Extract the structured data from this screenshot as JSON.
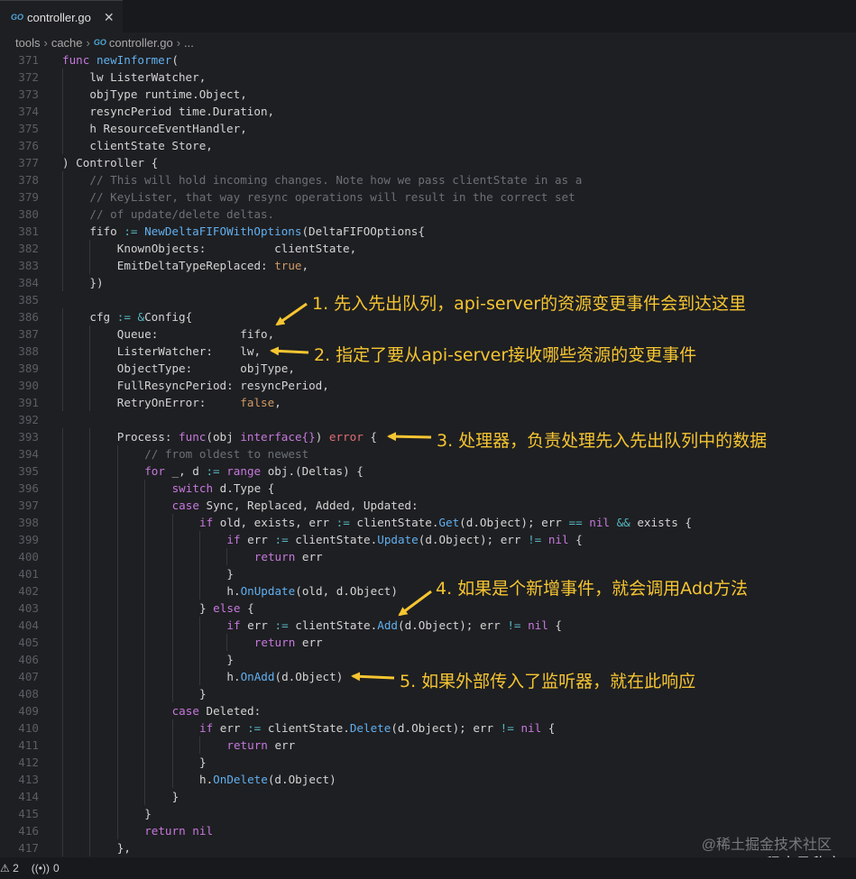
{
  "tab": {
    "icon": "go-file-icon",
    "icon_text": "GO",
    "filename": "controller.go",
    "close": "✕"
  },
  "breadcrumb": {
    "parts": [
      "tools",
      "cache",
      "controller.go",
      "..."
    ],
    "file_icon_text": "GO"
  },
  "code_lines": [
    {
      "n": "371",
      "i": 0,
      "tokens": [
        [
          "func",
          "k"
        ],
        [
          " ",
          ""
        ],
        [
          "newInformer",
          "f"
        ],
        [
          "(",
          ""
        ]
      ]
    },
    {
      "n": "372",
      "i": 1,
      "tokens": [
        [
          "lw ListerWatcher,",
          ""
        ]
      ]
    },
    {
      "n": "373",
      "i": 1,
      "tokens": [
        [
          "objType runtime.Object,",
          ""
        ]
      ]
    },
    {
      "n": "374",
      "i": 1,
      "tokens": [
        [
          "resyncPeriod time.Duration,",
          ""
        ]
      ]
    },
    {
      "n": "375",
      "i": 1,
      "tokens": [
        [
          "h ResourceEventHandler,",
          ""
        ]
      ]
    },
    {
      "n": "376",
      "i": 1,
      "tokens": [
        [
          "clientState Store,",
          ""
        ]
      ]
    },
    {
      "n": "377",
      "i": 0,
      "tokens": [
        [
          ") Controller {",
          ""
        ]
      ]
    },
    {
      "n": "378",
      "i": 1,
      "tokens": [
        [
          "// This will hold incoming changes. Note how we pass clientState in as a",
          "c"
        ]
      ]
    },
    {
      "n": "379",
      "i": 1,
      "tokens": [
        [
          "// KeyLister, that way resync operations will result in the correct set",
          "c"
        ]
      ]
    },
    {
      "n": "380",
      "i": 1,
      "tokens": [
        [
          "// of update/delete deltas.",
          "c"
        ]
      ]
    },
    {
      "n": "381",
      "i": 1,
      "tokens": [
        [
          "fifo ",
          ""
        ],
        [
          ":=",
          "o"
        ],
        [
          " ",
          ""
        ],
        [
          "NewDeltaFIFOWithOptions",
          "f"
        ],
        [
          "(DeltaFIFOOptions{",
          ""
        ]
      ]
    },
    {
      "n": "382",
      "i": 2,
      "tokens": [
        [
          "KnownObjects:          clientState,",
          ""
        ]
      ]
    },
    {
      "n": "383",
      "i": 2,
      "tokens": [
        [
          "EmitDeltaTypeReplaced: ",
          ""
        ],
        [
          "true",
          "b"
        ],
        [
          ",",
          ""
        ]
      ]
    },
    {
      "n": "384",
      "i": 1,
      "tokens": [
        [
          "})",
          ""
        ]
      ]
    },
    {
      "n": "385",
      "i": 0,
      "tokens": []
    },
    {
      "n": "386",
      "i": 1,
      "tokens": [
        [
          "cfg ",
          ""
        ],
        [
          ":=",
          "o"
        ],
        [
          " ",
          ""
        ],
        [
          "&",
          "o"
        ],
        [
          "Config{",
          ""
        ]
      ]
    },
    {
      "n": "387",
      "i": 2,
      "tokens": [
        [
          "Queue:            fifo,",
          ""
        ]
      ]
    },
    {
      "n": "388",
      "i": 2,
      "tokens": [
        [
          "ListerWatcher:    lw,",
          ""
        ]
      ]
    },
    {
      "n": "389",
      "i": 2,
      "tokens": [
        [
          "ObjectType:       objType,",
          ""
        ]
      ]
    },
    {
      "n": "390",
      "i": 2,
      "tokens": [
        [
          "FullResyncPeriod: resyncPeriod,",
          ""
        ]
      ]
    },
    {
      "n": "391",
      "i": 2,
      "tokens": [
        [
          "RetryOnError:     ",
          ""
        ],
        [
          "false",
          "b"
        ],
        [
          ",",
          ""
        ]
      ]
    },
    {
      "n": "392",
      "i": 0,
      "tokens": []
    },
    {
      "n": "393",
      "i": 2,
      "tokens": [
        [
          "Process: ",
          ""
        ],
        [
          "func",
          "k"
        ],
        [
          "(obj ",
          ""
        ],
        [
          "interface{}",
          "k"
        ],
        [
          ") ",
          ""
        ],
        [
          "error",
          "r"
        ],
        [
          " {",
          ""
        ]
      ]
    },
    {
      "n": "394",
      "i": 3,
      "tokens": [
        [
          "// from oldest to newest",
          "c"
        ]
      ]
    },
    {
      "n": "395",
      "i": 3,
      "tokens": [
        [
          "for",
          "k"
        ],
        [
          " _, d ",
          ""
        ],
        [
          ":=",
          "o"
        ],
        [
          " ",
          ""
        ],
        [
          "range",
          "k"
        ],
        [
          " obj.(Deltas) {",
          ""
        ]
      ]
    },
    {
      "n": "396",
      "i": 4,
      "tokens": [
        [
          "switch",
          "k"
        ],
        [
          " d.Type {",
          ""
        ]
      ]
    },
    {
      "n": "397",
      "i": 4,
      "tokens": [
        [
          "case",
          "k"
        ],
        [
          " Sync, Replaced, Added, Updated:",
          ""
        ]
      ]
    },
    {
      "n": "398",
      "i": 5,
      "tokens": [
        [
          "if",
          "k"
        ],
        [
          " old, exists, err ",
          ""
        ],
        [
          ":=",
          "o"
        ],
        [
          " clientState.",
          ""
        ],
        [
          "Get",
          "f"
        ],
        [
          "(d.Object); err ",
          ""
        ],
        [
          "==",
          "o"
        ],
        [
          " ",
          ""
        ],
        [
          "nil",
          "k"
        ],
        [
          " ",
          ""
        ],
        [
          "&&",
          "o"
        ],
        [
          " exists {",
          ""
        ]
      ]
    },
    {
      "n": "399",
      "i": 6,
      "tokens": [
        [
          "if",
          "k"
        ],
        [
          " err ",
          ""
        ],
        [
          ":=",
          "o"
        ],
        [
          " clientState.",
          ""
        ],
        [
          "Update",
          "f"
        ],
        [
          "(d.Object); err ",
          ""
        ],
        [
          "!=",
          "o"
        ],
        [
          " ",
          ""
        ],
        [
          "nil",
          "k"
        ],
        [
          " {",
          ""
        ]
      ]
    },
    {
      "n": "400",
      "i": 7,
      "tokens": [
        [
          "return",
          "k"
        ],
        [
          " err",
          ""
        ]
      ]
    },
    {
      "n": "401",
      "i": 6,
      "tokens": [
        [
          "}",
          ""
        ]
      ]
    },
    {
      "n": "402",
      "i": 6,
      "tokens": [
        [
          "h.",
          ""
        ],
        [
          "OnUpdate",
          "f"
        ],
        [
          "(old, d.Object)",
          ""
        ]
      ]
    },
    {
      "n": "403",
      "i": 5,
      "tokens": [
        [
          "} ",
          ""
        ],
        [
          "else",
          "k"
        ],
        [
          " {",
          ""
        ]
      ]
    },
    {
      "n": "404",
      "i": 6,
      "tokens": [
        [
          "if",
          "k"
        ],
        [
          " err ",
          ""
        ],
        [
          ":=",
          "o"
        ],
        [
          " clientState.",
          ""
        ],
        [
          "Add",
          "f"
        ],
        [
          "(d.Object); err ",
          ""
        ],
        [
          "!=",
          "o"
        ],
        [
          " ",
          ""
        ],
        [
          "nil",
          "k"
        ],
        [
          " {",
          ""
        ]
      ]
    },
    {
      "n": "405",
      "i": 7,
      "tokens": [
        [
          "return",
          "k"
        ],
        [
          " err",
          ""
        ]
      ]
    },
    {
      "n": "406",
      "i": 6,
      "tokens": [
        [
          "}",
          ""
        ]
      ]
    },
    {
      "n": "407",
      "i": 6,
      "tokens": [
        [
          "h.",
          ""
        ],
        [
          "OnAdd",
          "f"
        ],
        [
          "(d.Object)",
          ""
        ]
      ]
    },
    {
      "n": "408",
      "i": 5,
      "tokens": [
        [
          "}",
          ""
        ]
      ]
    },
    {
      "n": "409",
      "i": 4,
      "tokens": [
        [
          "case",
          "k"
        ],
        [
          " Deleted:",
          ""
        ]
      ]
    },
    {
      "n": "410",
      "i": 5,
      "tokens": [
        [
          "if",
          "k"
        ],
        [
          " err ",
          ""
        ],
        [
          ":=",
          "o"
        ],
        [
          " clientState.",
          ""
        ],
        [
          "Delete",
          "f"
        ],
        [
          "(d.Object); err ",
          ""
        ],
        [
          "!=",
          "o"
        ],
        [
          " ",
          ""
        ],
        [
          "nil",
          "k"
        ],
        [
          " {",
          ""
        ]
      ]
    },
    {
      "n": "411",
      "i": 6,
      "tokens": [
        [
          "return",
          "k"
        ],
        [
          " err",
          ""
        ]
      ]
    },
    {
      "n": "412",
      "i": 5,
      "tokens": [
        [
          "}",
          ""
        ]
      ]
    },
    {
      "n": "413",
      "i": 5,
      "tokens": [
        [
          "h.",
          ""
        ],
        [
          "OnDelete",
          "f"
        ],
        [
          "(d.Object)",
          ""
        ]
      ]
    },
    {
      "n": "414",
      "i": 4,
      "tokens": [
        [
          "}",
          ""
        ]
      ]
    },
    {
      "n": "415",
      "i": 3,
      "tokens": [
        [
          "}",
          ""
        ]
      ]
    },
    {
      "n": "416",
      "i": 3,
      "tokens": [
        [
          "return",
          "k"
        ],
        [
          " ",
          ""
        ],
        [
          "nil",
          "k"
        ]
      ]
    },
    {
      "n": "417",
      "i": 2,
      "tokens": [
        [
          "},",
          ""
        ]
      ]
    }
  ],
  "annotations": [
    {
      "text": "1. 先入先出队列，api-server的资源变更事件会到达这里"
    },
    {
      "text": "2. 指定了要从api-server接收哪些资源的变更事件"
    },
    {
      "text": "3. 处理器，负责处理先入先出队列中的数据"
    },
    {
      "text": "4. 如果是个新增事件，就会调用Add方法"
    },
    {
      "text": "5. 如果外部传入了监听器，就在此响应"
    }
  ],
  "colors": {
    "annotation": "#f6c531",
    "background": "#1e1f22",
    "keyword": "#c678dd",
    "function": "#61afef",
    "comment": "#6b7078"
  },
  "status": {
    "warnings": "⚠ 2",
    "signal_icon": "broadcast-icon",
    "signal": "0"
  },
  "watermark": {
    "line1": "@稀土掘金技术社区",
    "line2": "CSDN @程序员欣宸"
  }
}
